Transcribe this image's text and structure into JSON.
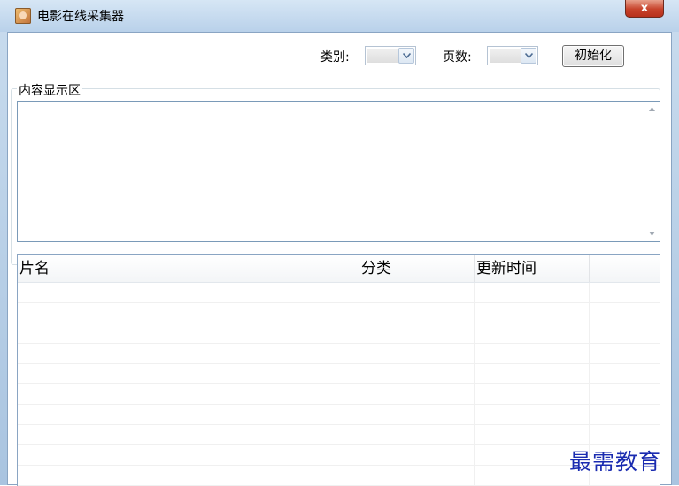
{
  "window": {
    "title": "电影在线采集器",
    "close_glyph": "x"
  },
  "toolbar": {
    "category_label": "类别:",
    "category_value": "",
    "pages_label": "页数:",
    "pages_value": "",
    "init_button": "初始化"
  },
  "content_group": {
    "title": "内容显示区",
    "text": ""
  },
  "table": {
    "columns": [
      "片名",
      "分类",
      "更新时间",
      ""
    ],
    "rows": [
      [
        "",
        "",
        "",
        ""
      ],
      [
        "",
        "",
        "",
        ""
      ],
      [
        "",
        "",
        "",
        ""
      ],
      [
        "",
        "",
        "",
        ""
      ],
      [
        "",
        "",
        "",
        ""
      ],
      [
        "",
        "",
        "",
        ""
      ],
      [
        "",
        "",
        "",
        ""
      ],
      [
        "",
        "",
        "",
        ""
      ],
      [
        "",
        "",
        "",
        ""
      ],
      [
        "",
        "",
        "",
        ""
      ]
    ]
  },
  "watermark": "最需教育",
  "icons": {
    "app": "movie-app-icon",
    "close": "close-icon",
    "dropdown": "chevron-down-icon",
    "scroll_up": "scroll-up-arrow-icon",
    "scroll_down": "scroll-down-arrow-icon"
  }
}
